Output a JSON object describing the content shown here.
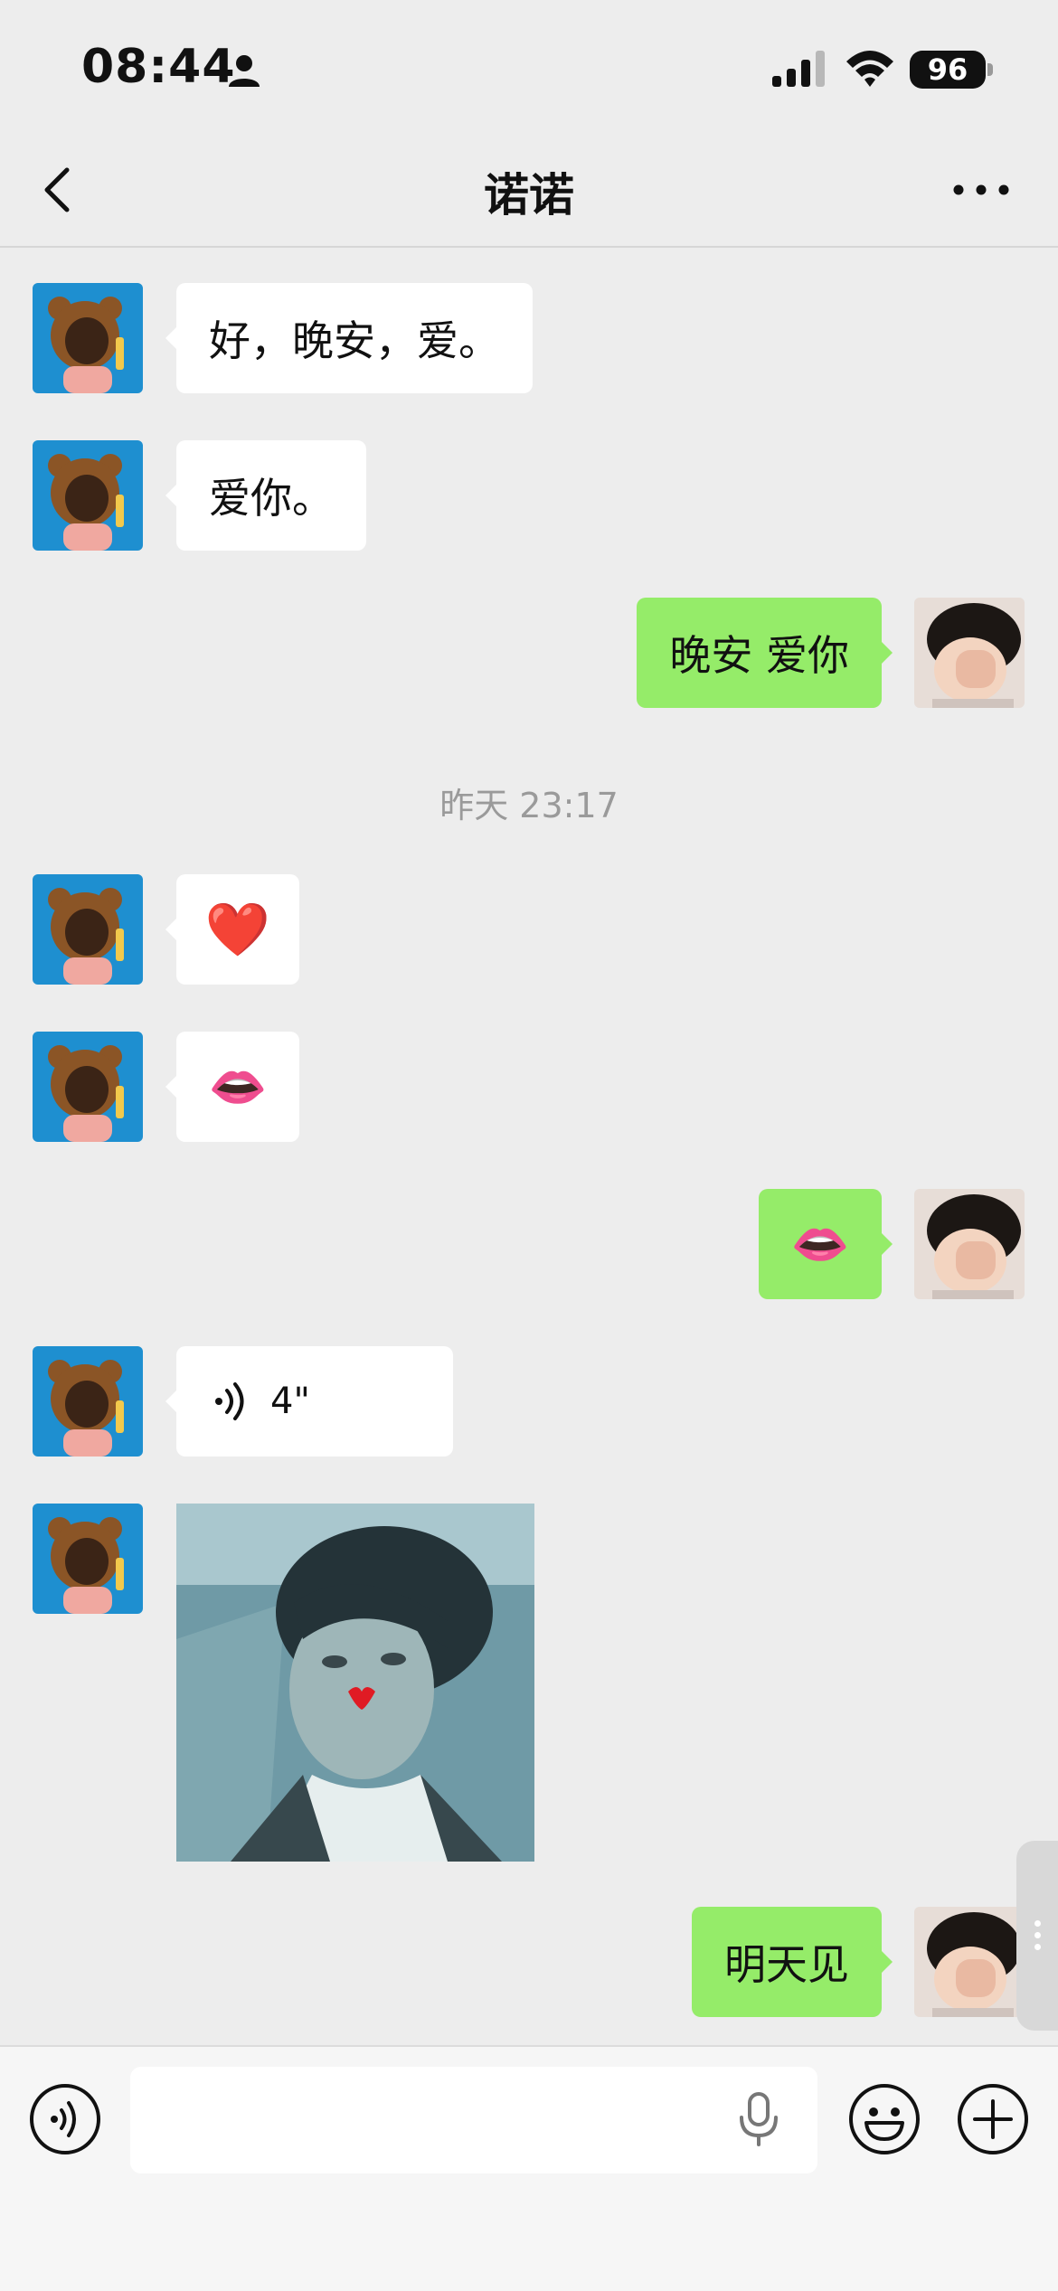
{
  "status_bar": {
    "time": "08:44",
    "battery": "96"
  },
  "chat": {
    "title": "诺诺",
    "timestamp": "昨天 23:17",
    "messages": {
      "m1": "好，晚安，爱。",
      "m2": "爱你。",
      "m3": "晚安 爱你",
      "m4": "❤️",
      "m5": "👄",
      "m6": "👄",
      "m7_duration": "4\"",
      "m9": "明天见"
    }
  },
  "input": {
    "placeholder": ""
  },
  "icons": [
    "person-icon",
    "signal-icon",
    "wifi-icon",
    "back-icon",
    "more-icon",
    "voice-wave-icon",
    "voice-toggle-icon",
    "mic-icon",
    "emoji-icon",
    "plus-icon"
  ],
  "colors": {
    "background": "#ededed",
    "sent_bubble": "#95ec69",
    "received_bubble": "#ffffff",
    "avatar_left_bg": "#1e8fd0"
  }
}
